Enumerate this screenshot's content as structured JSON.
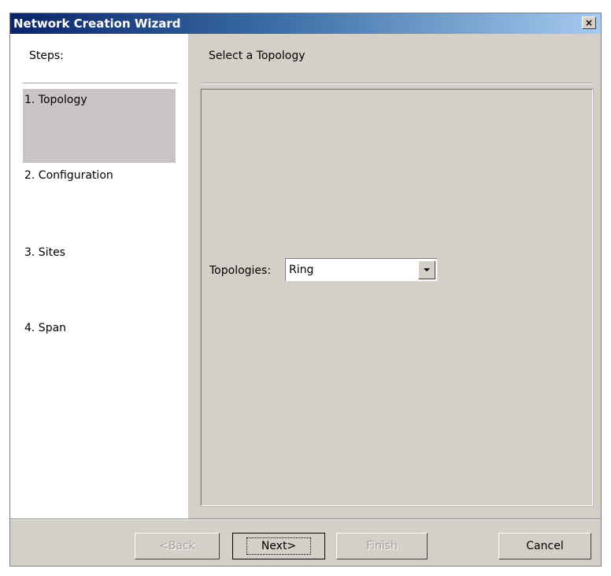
{
  "window": {
    "title": "Network Creation Wizard",
    "close_glyph": "×"
  },
  "steps": {
    "header": "Steps:",
    "items": [
      {
        "label": "1. Topology",
        "active": true
      },
      {
        "label": "2. Configuration",
        "active": false
      },
      {
        "label": "3. Sites",
        "active": false
      },
      {
        "label": "4. Span",
        "active": false
      }
    ]
  },
  "content": {
    "header": "Select a Topology",
    "topologies_label": "Topologies:",
    "topologies_value": "Ring"
  },
  "buttons": {
    "back": "<Back",
    "next": "Next>",
    "finish": "Finish",
    "cancel": "Cancel"
  },
  "icons": {
    "close": "close-icon",
    "dropdown": "chevron-down-icon"
  }
}
